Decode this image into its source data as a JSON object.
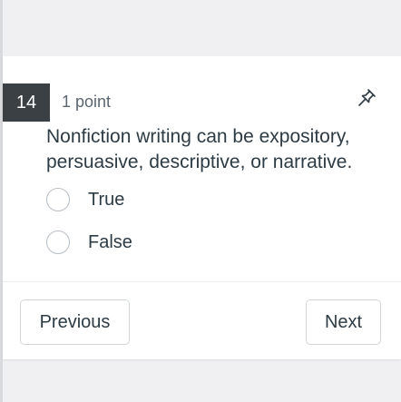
{
  "question": {
    "number": "14",
    "points": "1 point",
    "text": "Nonfiction writing can be expository, persuasive, descriptive, or narrative.",
    "pin_icon": "pin-icon"
  },
  "answers": [
    {
      "label": "True",
      "selected": false
    },
    {
      "label": "False",
      "selected": false
    }
  ],
  "navigation": {
    "previous_label": "Previous",
    "next_label": "Next"
  },
  "colors": {
    "number_badge_bg": "#3b4045",
    "text": "#2d3b45",
    "page_bg": "#f0f0f2"
  }
}
